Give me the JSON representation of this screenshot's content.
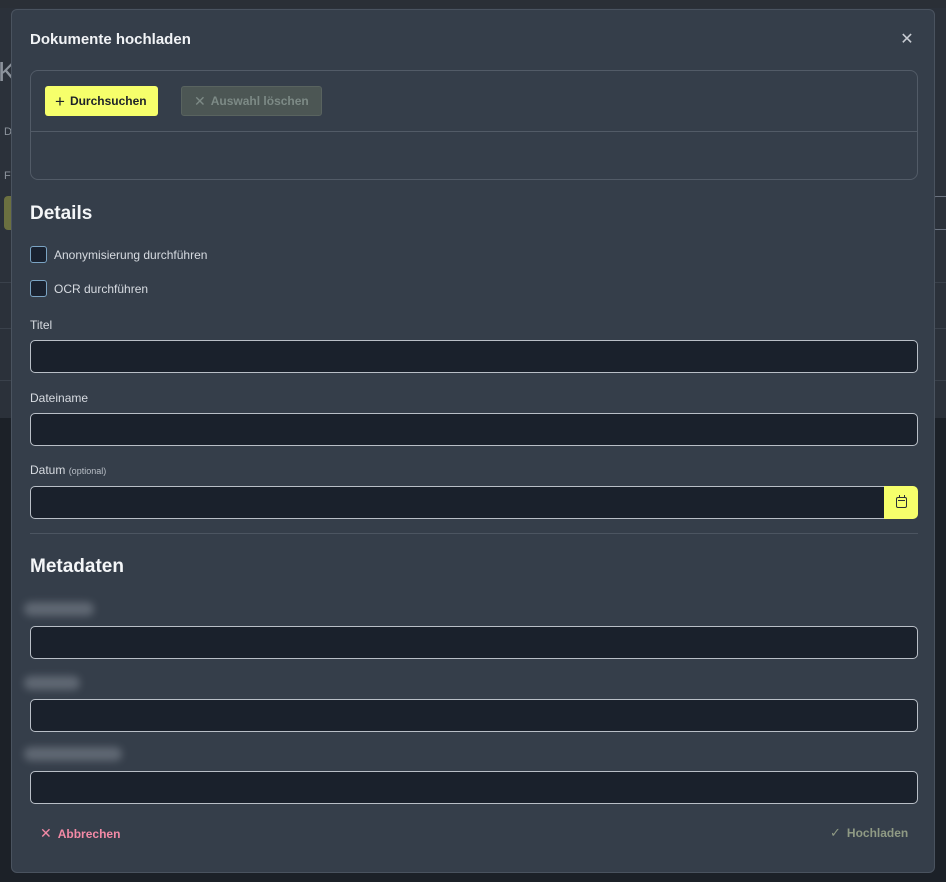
{
  "dialog": {
    "title": "Dokumente hochladen",
    "close_icon": "close-icon"
  },
  "upload": {
    "browse_label": "Durchsuchen",
    "clear_label": "Auswahl löschen"
  },
  "details": {
    "heading": "Details",
    "anonymize_label": "Anonymisierung durchführen",
    "ocr_label": "OCR durchführen",
    "title_label": "Titel",
    "title_value": "",
    "filename_label": "Dateiname",
    "filename_value": "",
    "date_label": "Datum",
    "date_optional": "(optional)",
    "date_value": ""
  },
  "metadata": {
    "heading": "Metadaten",
    "fields": [
      {
        "value": ""
      },
      {
        "value": ""
      },
      {
        "value": ""
      }
    ]
  },
  "footer": {
    "cancel_label": "Abbrechen",
    "upload_label": "Hochladen"
  },
  "colors": {
    "accent": "#f6ff6b",
    "cancel": "#f38aa6",
    "modal_bg": "#353e4a"
  }
}
